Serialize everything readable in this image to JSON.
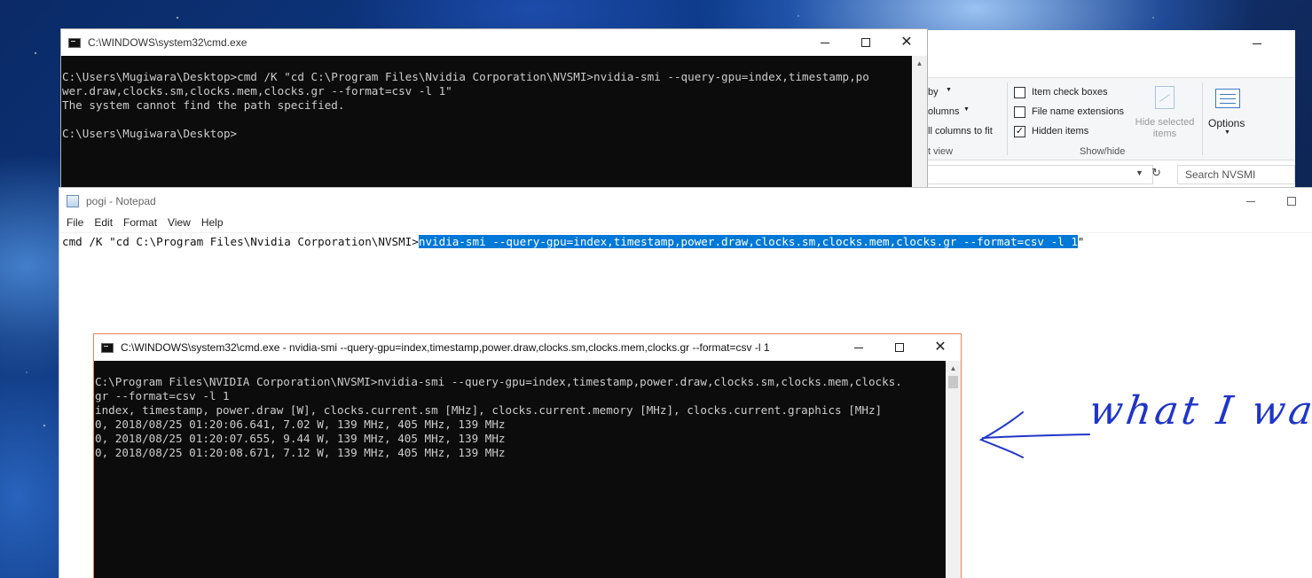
{
  "cmd1": {
    "title": "C:\\WINDOWS\\system32\\cmd.exe",
    "lines": [
      "C:\\Users\\Mugiwara\\Desktop>cmd /K \"cd C:\\Program Files\\Nvidia Corporation\\NVSMI>nvidia-smi --query-gpu=index,timestamp,po",
      "wer.draw,clocks.sm,clocks.mem,clocks.gr --format=csv -l 1\"",
      "The system cannot find the path specified.",
      "",
      "C:\\Users\\Mugiwara\\Desktop>"
    ]
  },
  "explorer": {
    "ribbon": {
      "sort_by": "by",
      "add_columns": "olumns",
      "size_columns": "ll columns to fit",
      "group_label_view": "t view",
      "item_check_boxes": "Item check boxes",
      "file_name_extensions": "File name extensions",
      "hidden_items": "Hidden items",
      "item_check_boxes_checked": false,
      "file_name_extensions_checked": false,
      "hidden_items_checked": true,
      "group_label_show_hide": "Show/hide",
      "hide_selected_line1": "Hide selected",
      "hide_selected_line2": "items",
      "options": "Options"
    },
    "search_placeholder": "Search NVSMI"
  },
  "notepad": {
    "title": "pogi - Notepad",
    "menu": [
      "File",
      "Edit",
      "Format",
      "View",
      "Help"
    ],
    "text_before": "cmd /K \"cd C:\\Program Files\\Nvidia Corporation\\NVSMI>",
    "text_selected": "nvidia-smi --query-gpu=index,timestamp,power.draw,clocks.sm,clocks.mem,clocks.gr --format=csv -l 1",
    "text_after": "\""
  },
  "cmd2": {
    "title": "C:\\WINDOWS\\system32\\cmd.exe - nvidia-smi  --query-gpu=index,timestamp,power.draw,clocks.sm,clocks.mem,clocks.gr --format=csv -l 1",
    "lines": [
      "C:\\Program Files\\NVIDIA Corporation\\NVSMI>nvidia-smi --query-gpu=index,timestamp,power.draw,clocks.sm,clocks.mem,clocks.",
      "gr --format=csv -l 1",
      "index, timestamp, power.draw [W], clocks.current.sm [MHz], clocks.current.memory [MHz], clocks.current.graphics [MHz]",
      "0, 2018/08/25 01:20:06.641, 7.02 W, 139 MHz, 405 MHz, 139 MHz",
      "0, 2018/08/25 01:20:07.655, 9.44 W, 139 MHz, 405 MHz, 139 MHz",
      "0, 2018/08/25 01:20:08.671, 7.12 W, 139 MHz, 405 MHz, 139 MHz"
    ]
  },
  "annotation": {
    "text": "what I want",
    "color": "#1f35c9"
  }
}
